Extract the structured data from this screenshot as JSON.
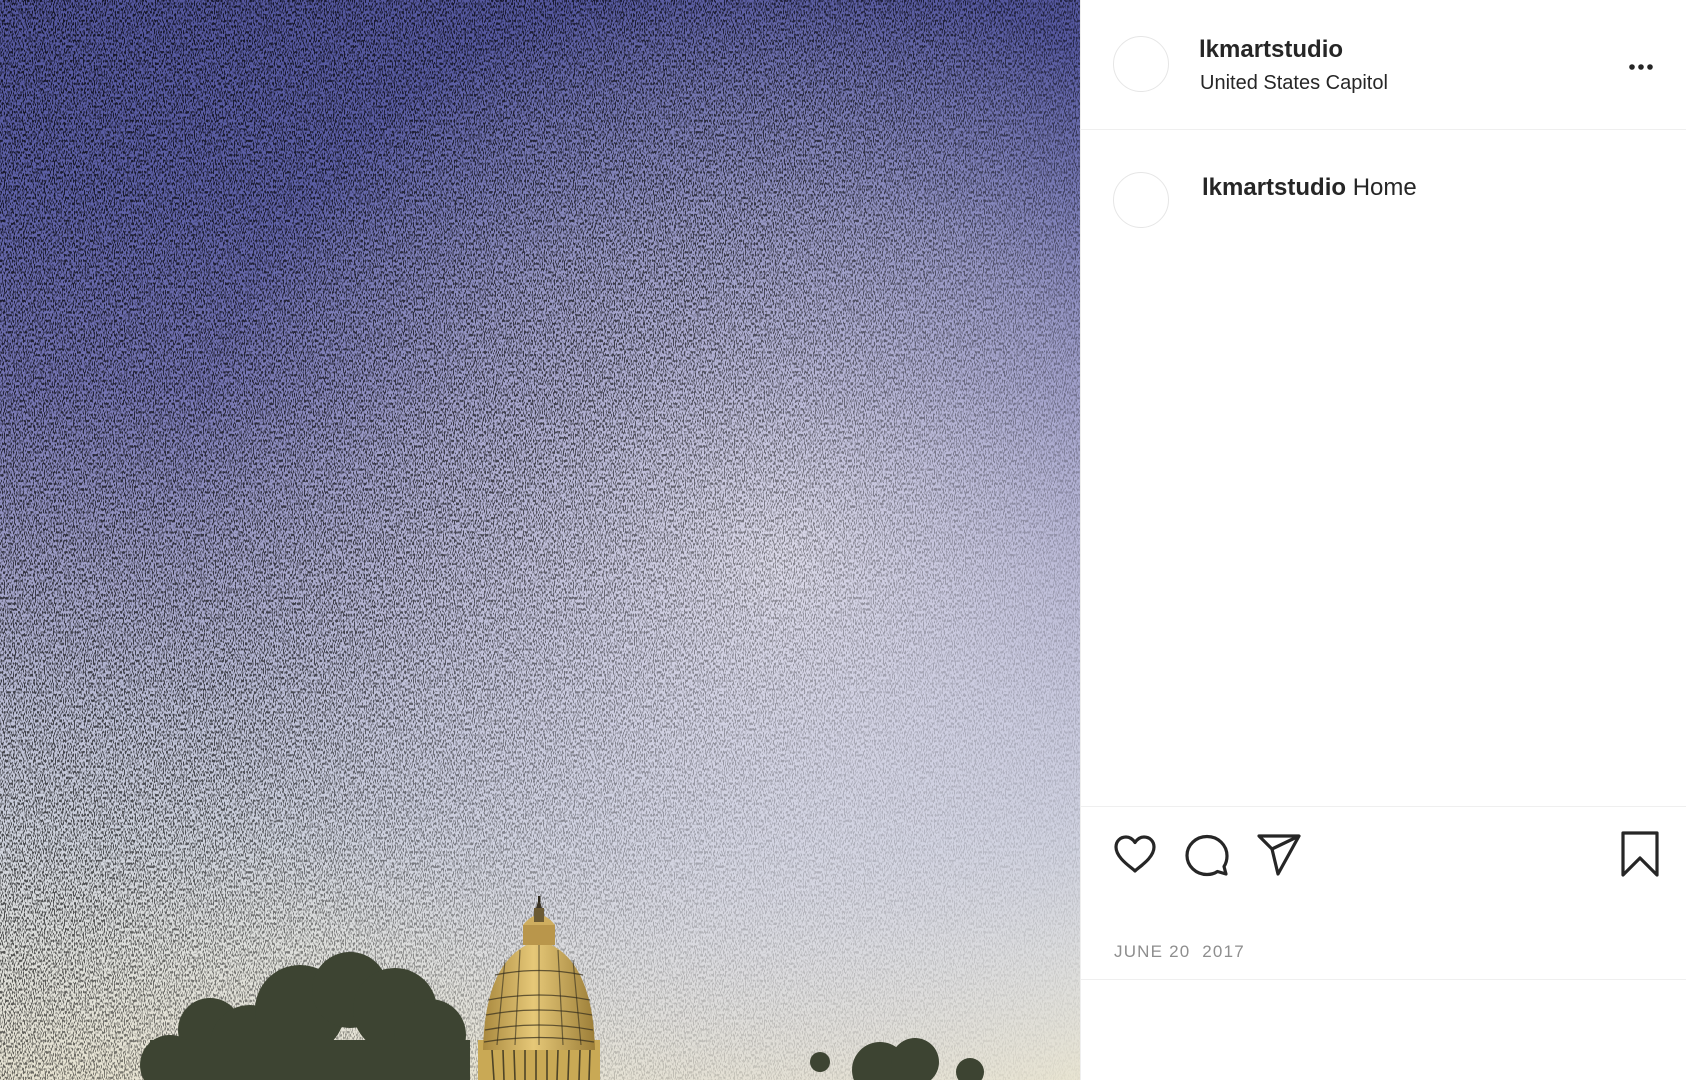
{
  "post": {
    "username": "lkmartstudio",
    "location": "United States Capitol",
    "caption": {
      "username": "lkmartstudio",
      "text": "Home"
    },
    "date": "JUNE 20  2017"
  },
  "icons": {
    "more": "more-options-icon",
    "like": "heart-icon",
    "comment": "comment-bubble-icon",
    "share": "paper-plane-icon",
    "save": "bookmark-icon"
  },
  "colors": {
    "text": "#262626",
    "muted": "#8e8e8e",
    "divider": "#efefef",
    "sky_top": "#54579e",
    "sky_bottom": "#e8e4d2"
  }
}
